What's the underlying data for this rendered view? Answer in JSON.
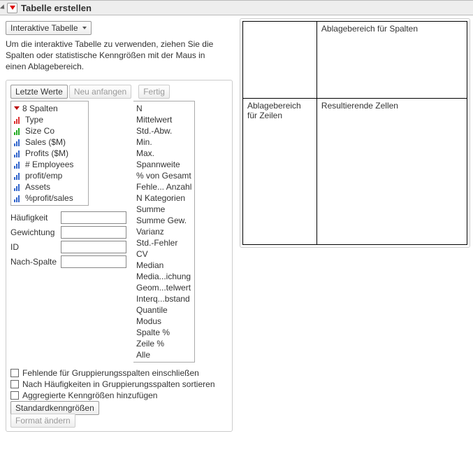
{
  "header": {
    "title": "Tabelle erstellen"
  },
  "dropdown": {
    "label": "Interaktive Tabelle"
  },
  "description": "Um die interaktive Tabelle zu verwenden, ziehen Sie die Spalten oder statistische Kenngrößen mit der Maus in einen Ablagebereich.",
  "buttons": {
    "letzte": "Letzte Werte",
    "neu": "Neu anfangen",
    "fertig": "Fertig",
    "standard": "Standardkenngrößen",
    "format": "Format ändern"
  },
  "columns": {
    "header": "8 Spalten",
    "items": [
      {
        "label": "Type",
        "kind": "red"
      },
      {
        "label": "Size Co",
        "kind": "green"
      },
      {
        "label": "Sales ($M)",
        "kind": "blue"
      },
      {
        "label": "Profits ($M)",
        "kind": "blue"
      },
      {
        "label": "# Employees",
        "kind": "blue"
      },
      {
        "label": "profit/emp",
        "kind": "blue"
      },
      {
        "label": "Assets",
        "kind": "blue"
      },
      {
        "label": "%profit/sales",
        "kind": "blue"
      }
    ]
  },
  "fields": {
    "freq": "Häufigkeit",
    "weight": "Gewichtung",
    "id": "ID",
    "by": "Nach-Spalte"
  },
  "stats": [
    "N",
    "Mittelwert",
    "Std.-Abw.",
    "Min.",
    "Max.",
    "Spannweite",
    "% von Gesamt",
    "Fehle... Anzahl",
    "N Kategorien",
    "Summe",
    "Summe Gew.",
    "Varianz",
    "Std.-Fehler",
    "CV",
    "Median",
    "Media...ichung",
    "Geom...telwert",
    "Interq...bstand",
    "Quantile",
    "Modus",
    "Spalte %",
    "Zeile %",
    "Alle"
  ],
  "checks": {
    "missing": "Fehlende für Gruppierungsspalten einschließen",
    "sort": "Nach Häufigkeiten in Gruppierungsspalten sortieren",
    "agg": "Aggregierte Kenngrößen hinzufügen"
  },
  "dropzones": {
    "top_right": "Ablagebereich für Spalten",
    "bottom_left": "Ablagebereich für Zeilen",
    "bottom_right": "Resultierende Zellen"
  }
}
